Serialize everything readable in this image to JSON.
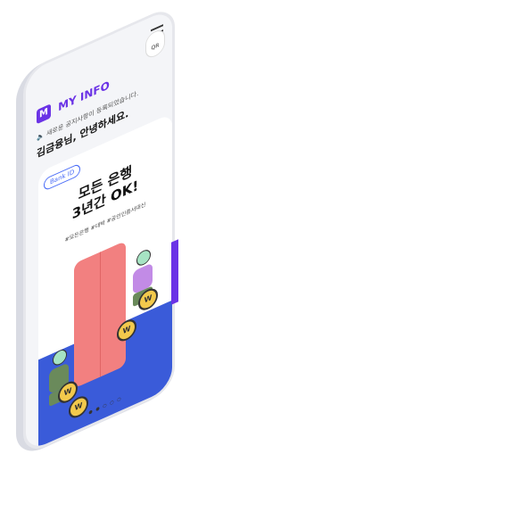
{
  "header": {
    "logo_letter": "M",
    "logo_text": "MY INFO",
    "qr_label": "QR"
  },
  "notice": "새로운 공지사항이 등록되었습니다.",
  "greeting": "김금융님, 안녕하세요.",
  "card": {
    "badge": "Bank ID",
    "headline_line1": "모든 은행",
    "headline_line2": "3년간 OK!",
    "tags": "#모든은행  #대박  #공인인증서대신",
    "footer": "● ● ○ ○ ○"
  },
  "coins": [
    "W",
    "W",
    "W",
    "W"
  ],
  "colors": {
    "brand": "#6b33e6",
    "accent_blue": "#3a5bd9",
    "card_pink": "#f28080"
  }
}
